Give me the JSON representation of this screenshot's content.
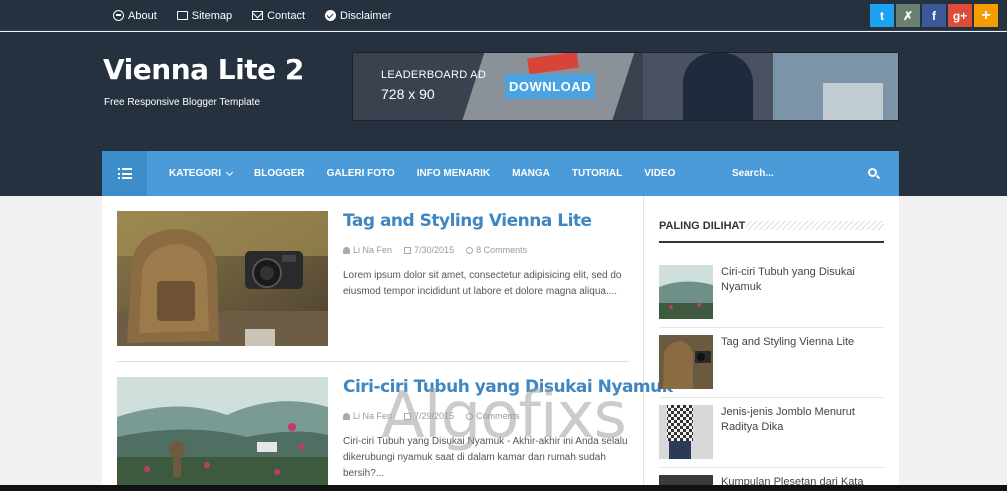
{
  "topbar": {
    "links": [
      {
        "label": "About",
        "icon": "info-circle-icon"
      },
      {
        "label": "Sitemap",
        "icon": "folder-icon"
      },
      {
        "label": "Contact",
        "icon": "envelope-icon"
      },
      {
        "label": "Disclaimer",
        "icon": "check-circle-icon"
      }
    ],
    "social": [
      {
        "glyph": "t",
        "icon": "twitter-icon",
        "color": "#1da1f2"
      },
      {
        "glyph": "✗",
        "icon": "delicious-icon",
        "color": "#6a8172"
      },
      {
        "glyph": "f",
        "icon": "facebook-icon",
        "color": "#3b5998"
      },
      {
        "glyph": "g+",
        "icon": "google-plus-icon",
        "color": "#dd4b39"
      },
      {
        "glyph": "+",
        "icon": "add-icon",
        "color": "#f59c00"
      }
    ]
  },
  "header": {
    "title": "Vienna Lite 2",
    "description": "Free Responsive Blogger Template",
    "ad": {
      "label": "LEADERBOARD AD",
      "size": "728 x 90",
      "button": "DOWNLOAD"
    }
  },
  "nav": {
    "items": [
      "KATEGORI",
      "BLOGGER",
      "GALERI FOTO",
      "INFO MENARIK",
      "MANGA",
      "TUTORIAL",
      "VIDEO"
    ],
    "search_placeholder": "Search..."
  },
  "posts": [
    {
      "title": "Tag and Styling Vienna Lite",
      "author": "Li Na Fen",
      "date": "7/30/2015",
      "comments": "8 Comments",
      "excerpt": "Lorem ipsum dolor sit amet, consectetur adipisicing elit, sed do eiusmod tempor incididunt ut labore et dolore magna aliqua...."
    },
    {
      "title": "Ciri-ciri Tubuh yang Disukai Nyamuk",
      "author": "Li Na Fen",
      "date": "7/29/2015",
      "comments": "Comments",
      "excerpt": "Ciri-ciri Tubuh yang Disukai Nyamuk - Akhir-akhir ini Anda selalu dikerubungi nyamuk saat di dalam kamar dan rumah sudah bersih?..."
    }
  ],
  "sidebar": {
    "title": "PALING DILIHAT",
    "items": [
      "Ciri-ciri Tubuh yang Disukai Nyamuk",
      "Tag and Styling Vienna Lite",
      "Jenis-jenis Jomblo Menurut Raditya Dika",
      "Kumpulan Plesetan dari Kata"
    ]
  },
  "watermark": "Algofixs"
}
